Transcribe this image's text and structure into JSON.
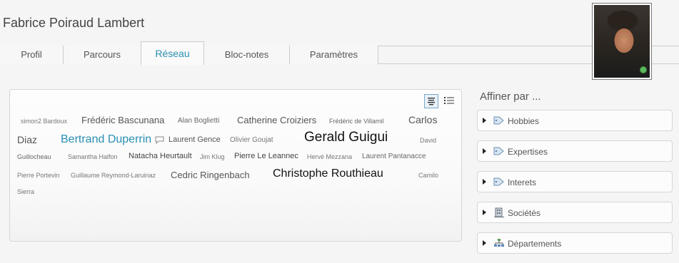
{
  "profile": {
    "name": "Fabrice Poiraud Lambert"
  },
  "tabs": [
    {
      "label": "Profil"
    },
    {
      "label": "Parcours"
    },
    {
      "label": "Réseau"
    },
    {
      "label": "Bloc-notes"
    },
    {
      "label": "Paramètres"
    }
  ],
  "view_toggle": {
    "cloud_icon": "tag-cloud-icon",
    "list_icon": "list-icon"
  },
  "network": {
    "people": [
      "simon2 Bardoux",
      "Frédéric Bascunana",
      "Alan Boglietti",
      "Catherine Croiziers",
      "Frédéric de Villamil",
      "Carlos",
      "Diaz",
      "Bertrand Duperrin",
      "Laurent Gence",
      "Olivier Goujat",
      "Gerald Guigui",
      "David",
      "Guillocheau",
      "Samantha Halfon",
      "Natacha Heurtault",
      "Jim Klug",
      "Pierre Le Leannec",
      "Hervé Mezzana",
      "Laurent Pantanacce",
      "Pierre Portevin",
      "Guillaume Reymond-Laruinaz",
      "Cedric Ringenbach",
      "Christophe Routhieau",
      "Camilo",
      "Sierra"
    ]
  },
  "refine": {
    "title": "Affiner par ...",
    "facets": [
      {
        "label": "Hobbies",
        "icon": "tag-icon"
      },
      {
        "label": "Expertises",
        "icon": "tag-icon"
      },
      {
        "label": "Interets",
        "icon": "tag-icon"
      },
      {
        "label": "Sociétés",
        "icon": "building-icon"
      },
      {
        "label": "Départements",
        "icon": "org-chart-icon"
      }
    ]
  },
  "colors": {
    "accent": "#2a8fb3",
    "status_online": "#5cb85c"
  }
}
